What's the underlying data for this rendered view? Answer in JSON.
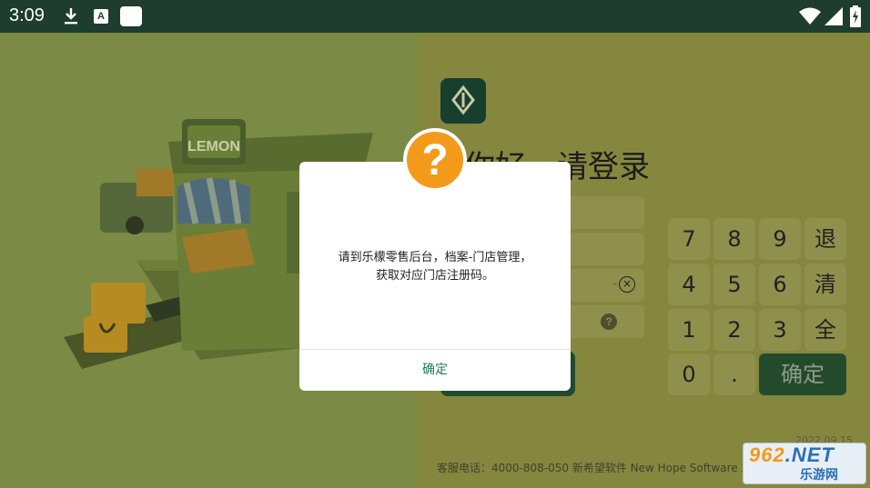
{
  "status_bar": {
    "time": "3:09",
    "icons": [
      "download-icon",
      "a-icon",
      "square-icon",
      "wifi-icon",
      "signal-icon",
      "battery-icon"
    ]
  },
  "login": {
    "heading": "你好，请登录",
    "fields": [
      {
        "placeholder": ""
      },
      {
        "placeholder": ""
      },
      {
        "placeholder": ""
      },
      {
        "placeholder": ""
      }
    ],
    "keypad": [
      [
        "7",
        "8",
        "9",
        "退"
      ],
      [
        "4",
        "5",
        "6",
        "清"
      ],
      [
        "1",
        "2",
        "3",
        "全"
      ],
      [
        "0",
        "."
      ]
    ],
    "keypad_confirm": "确定",
    "date": "2022.09.15",
    "footer": "客服电话：4000-808-050 新希望软件 New Hope Software 20"
  },
  "dialog": {
    "icon": "question-icon",
    "message_line1": "请到乐檬零售后台，档案-门店管理，",
    "message_line2": "获取对应门店注册码。",
    "confirm_label": "确定"
  },
  "watermark": {
    "top": "962",
    "top_suffix": ".NET",
    "bottom": "乐游网"
  },
  "colors": {
    "status_bar": "#1e3d2e",
    "accent_green": "#244a2c",
    "dialog_button": "#1f7d4f",
    "question_orange": "#f49a1b"
  }
}
